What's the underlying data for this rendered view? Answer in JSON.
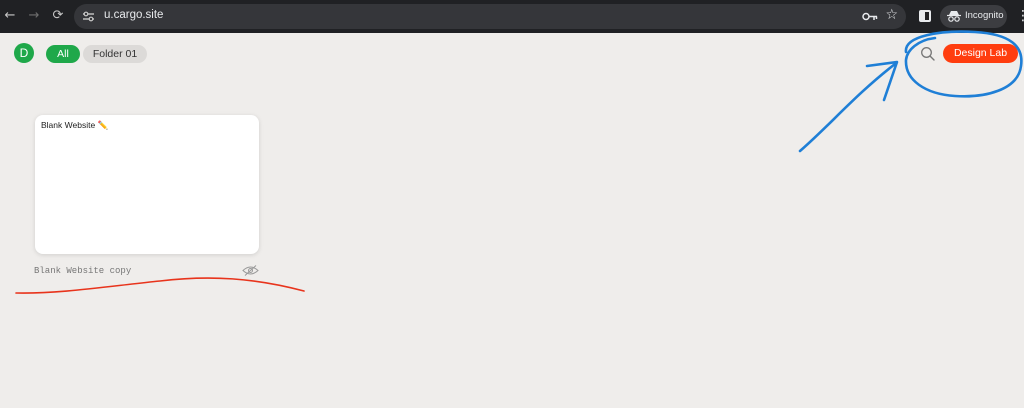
{
  "browser": {
    "url": "u.cargo.site",
    "incognito_label": "Incognito",
    "icons": [
      "back-arrow-icon",
      "forward-arrow-icon",
      "reload-icon",
      "site-info-icon",
      "key-icon",
      "star-icon",
      "side-panel-icon",
      "incognito-icon",
      "menu-icon"
    ]
  },
  "header": {
    "avatar_letter": "D",
    "filters": [
      {
        "label": "All",
        "active": true
      },
      {
        "label": "Folder 01",
        "active": false
      }
    ],
    "design_lab_label": "Design Lab"
  },
  "sites": [
    {
      "card_title": "Blank Website ✏️",
      "caption": "Blank Website copy",
      "status_icon": "hidden-eye-icon"
    }
  ],
  "colors": {
    "accent_green": "#1fa84a",
    "design_lab_orange": "#ff3d0f",
    "annotation_blue": "#1f7fd6",
    "annotation_red": "#e8341c",
    "page_background": "#efedeb"
  }
}
